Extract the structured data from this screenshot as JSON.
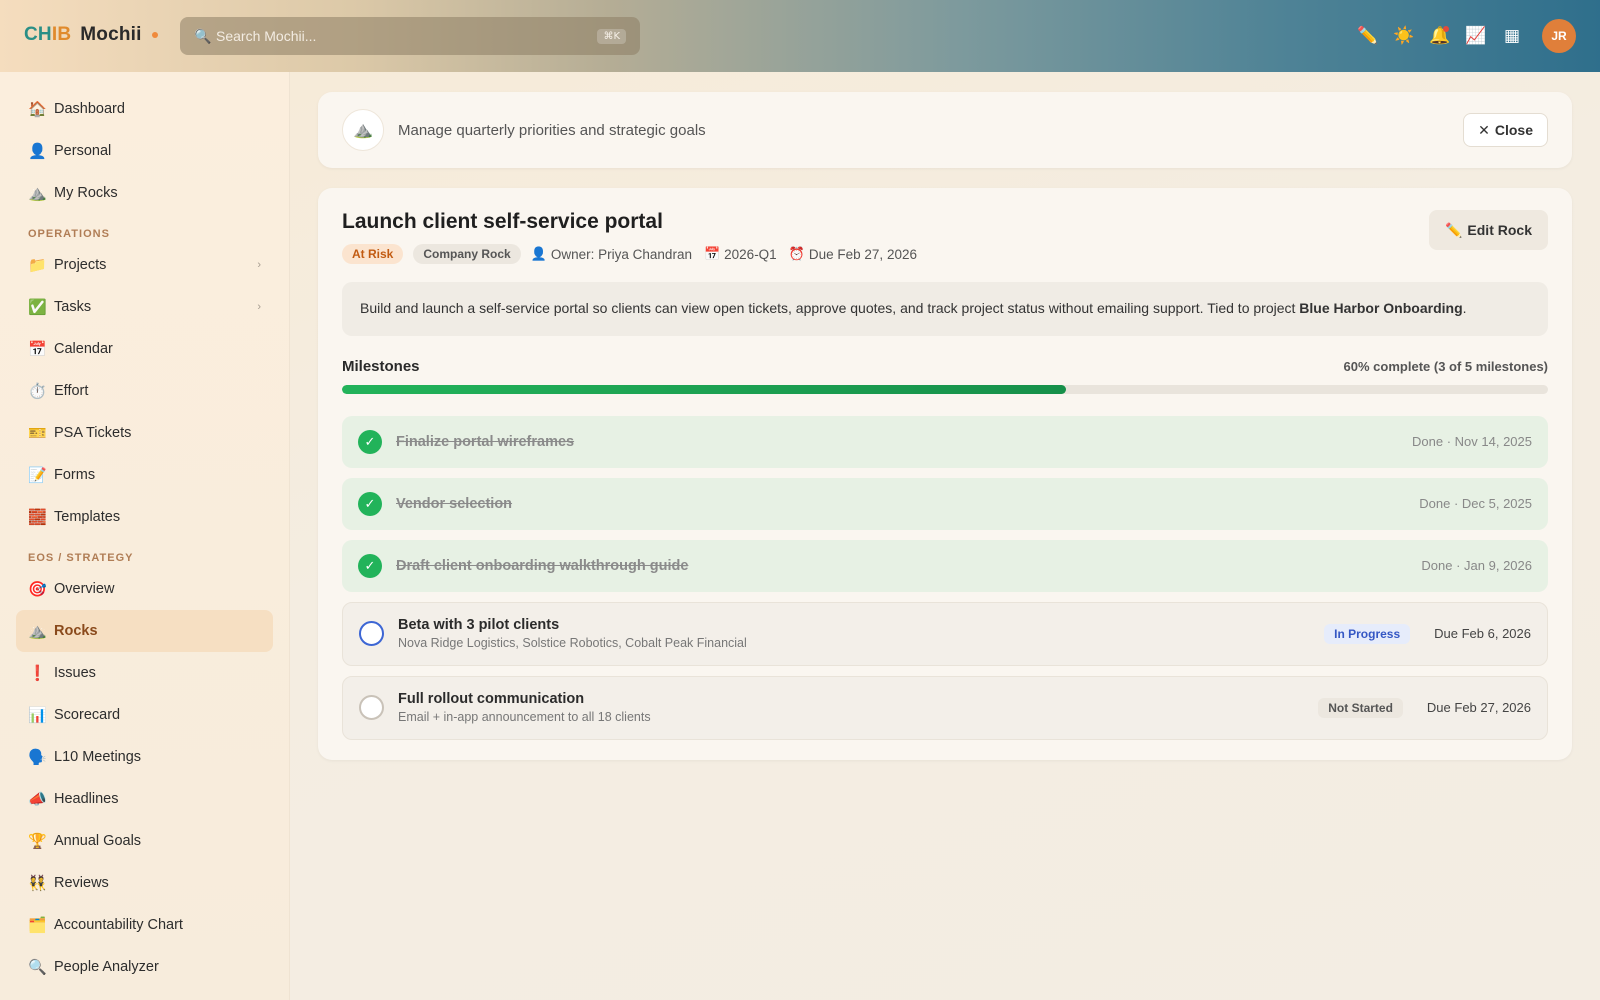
{
  "brand": {
    "part1": "CH",
    "part2": "IB",
    "part3": "Mochii"
  },
  "search": {
    "placeholder": "Search Mochii...",
    "shortcut": "⌘K"
  },
  "topbar": {
    "icons": [
      "pencil-icon",
      "sun-icon",
      "bell-icon",
      "chart-icon",
      "grid-icon"
    ],
    "avatar": "JR"
  },
  "sidebar": {
    "top_items": [
      {
        "icon": "🏠",
        "label": "Dashboard"
      },
      {
        "icon": "👤",
        "label": "Personal"
      },
      {
        "icon": "⛰️",
        "label": "My Rocks"
      }
    ],
    "operations_label": "OPERATIONS",
    "operations_items": [
      {
        "icon": "📁",
        "label": "Projects"
      },
      {
        "icon": "✅",
        "label": "Tasks"
      },
      {
        "icon": "📅",
        "label": "Calendar"
      },
      {
        "icon": "⏱️",
        "label": "Effort"
      },
      {
        "icon": "🎫",
        "label": "PSA Tickets"
      },
      {
        "icon": "📝",
        "label": "Forms"
      },
      {
        "icon": "🧱",
        "label": "Templates"
      }
    ],
    "eos_label": "EOS / STRATEGY",
    "eos_items": [
      {
        "icon": "🎯",
        "label": "Overview"
      },
      {
        "icon": "⛰️",
        "label": "Rocks"
      },
      {
        "icon": "❗",
        "label": "Issues"
      },
      {
        "icon": "📊",
        "label": "Scorecard"
      },
      {
        "icon": "🗣️",
        "label": "L10 Meetings"
      },
      {
        "icon": "📣",
        "label": "Headlines"
      },
      {
        "icon": "🏆",
        "label": "Annual Goals"
      },
      {
        "icon": "👯",
        "label": "Reviews"
      },
      {
        "icon": "🗂️",
        "label": "Accountability Chart"
      },
      {
        "icon": "🔍",
        "label": "People Analyzer"
      }
    ]
  },
  "header": {
    "subtitle": "Manage quarterly priorities and strategic goals",
    "close_label": "Close"
  },
  "rock": {
    "title": "Launch client self-service portal",
    "status_tag": "At Risk",
    "type_tag": "Company Rock",
    "owner": "Owner: Priya Chandran",
    "quarter": "2026-Q1",
    "due": "Due Feb 27, 2026",
    "edit_label": "Edit Rock",
    "description": "Build and launch a self-service portal so clients can view open tickets, approve quotes, and track project status without emailing support. Tied to project ",
    "description_project": "Blue Harbor Onboarding",
    "description_end": "."
  },
  "milestones": {
    "title": "Milestones",
    "progress_text": "60% complete (3 of 5 milestones)",
    "progress_fraction": 0.6,
    "items": [
      {
        "name": "Finalize portal wireframes",
        "date": "Done · Nov 14, 2025",
        "state": "done"
      },
      {
        "name": "Vendor selection",
        "date": "Done · Dec 5, 2025",
        "state": "done"
      },
      {
        "name": "Draft client onboarding walkthrough guide",
        "date": "Done · Jan 9, 2026",
        "state": "done"
      },
      {
        "name": "Beta with 3 pilot clients",
        "sub": "Nova Ridge Logistics, Solstice Robotics, Cobalt Peak Financial",
        "status": "In Progress",
        "date": "Due Feb 6, 2026",
        "state": "progress"
      },
      {
        "name": "Full rollout communication",
        "sub": "Email + in-app announcement to all 18 clients",
        "status": "Not Started",
        "date": "Due Feb 27, 2026",
        "state": "not-started"
      }
    ]
  }
}
